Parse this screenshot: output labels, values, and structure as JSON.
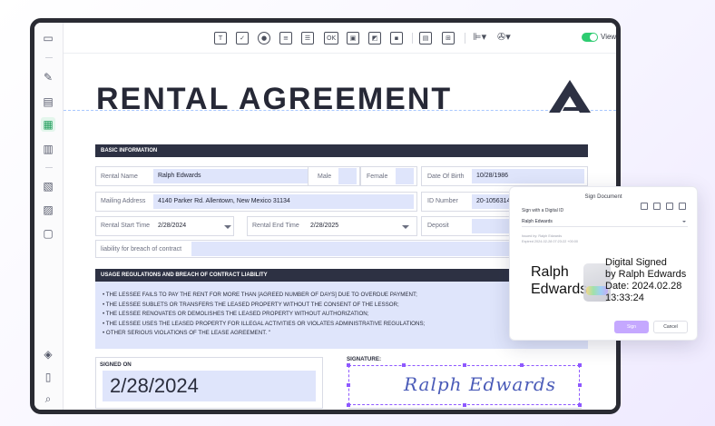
{
  "toolbar": {
    "tools": [
      "text-field-icon",
      "checkbox-icon",
      "radio-icon",
      "combo-box-icon",
      "list-box-icon",
      "button-icon",
      "image-field-icon",
      "image-icon",
      "date-field-icon",
      "align-icon",
      "grid-icon",
      "distribute-icon",
      "more-tools-icon"
    ],
    "ok_label": "OK",
    "view_label": "View"
  },
  "sidebar": {
    "items": [
      "thumbnail-icon",
      "comment-icon",
      "edit-icon",
      "form-icon",
      "organize-icon",
      "protect-icon",
      "ocr-icon",
      "tool-icon",
      "layers-icon",
      "bookmark-icon",
      "attachment-icon"
    ]
  },
  "document": {
    "title": "RENTAL AGREEMENT",
    "basic_section": "BASIC INFORMATION",
    "fields": {
      "rental_name_label": "Rental Name",
      "rental_name": "Ralph Edwards",
      "male_label": "Male",
      "female_label": "Female",
      "dob_label": "Date Of Birth",
      "dob": "10/28/1986",
      "mailing_label": "Mailing Address",
      "mailing": "4140 Parker Rd. Allentown, New Mexico 31134",
      "id_label": "ID Number",
      "id": "20-10563145-8",
      "start_label": "Rental Start Time",
      "start": "2/28/2024",
      "end_label": "Rental End Time",
      "end": "2/28/2025",
      "deposit_label": "Deposit",
      "liability_label": "liability for breach of contract"
    },
    "usage_section": "USAGE REGULATIONS AND BREACH OF CONTRACT LIABILITY",
    "usage_lines": [
      "• THE LESSEE FAILS TO PAY THE RENT FOR MORE THAN [AGREED NUMBER OF DAYS] DUE TO OVERDUE PAYMENT;",
      "• THE LESSEE SUBLETS OR TRANSFERS THE LEASED PROPERTY WITHOUT THE CONSENT OF THE LESSOR;",
      "• THE LESSEE RENOVATES OR DEMOLISHES THE LEASED PROPERTY WITHOUT AUTHORIZATION;",
      "• THE LESSEE USES THE LEASED PROPERTY FOR ILLEGAL ACTIVITIES OR VIOLATES ADMINISTRATIVE REGULATIONS;",
      "• OTHER SERIOUS VIOLATIONS OF THE LEASE AGREEMENT. \""
    ],
    "signed_on_label": "SIGNED ON",
    "signed_on": "2/28/2024",
    "signature_label": "SIGNATURE:",
    "signature": "Ralph Edwards"
  },
  "popup": {
    "title": "Sign Document",
    "sub": "Sign with a Digital ID",
    "selected_id": "Ralph Edwards",
    "issued_by": "Issued by: Ralph Edwards",
    "expires": "Expired 2024-02-28 07:23:22 +00:00",
    "card_name_1": "Ralph",
    "card_name_2": "Edwards",
    "card_info": [
      "Digital Signed",
      "by Ralph Edwards",
      "Date: 2024.02.28",
      "13:33:24"
    ],
    "sign_label": "Sign",
    "cancel_label": "Cancel"
  },
  "colors": {
    "accent": "#8e58ff",
    "field_fill": "#dfe5fb",
    "header_dark": "#2d3143",
    "toggle_green": "#2ecc71"
  }
}
